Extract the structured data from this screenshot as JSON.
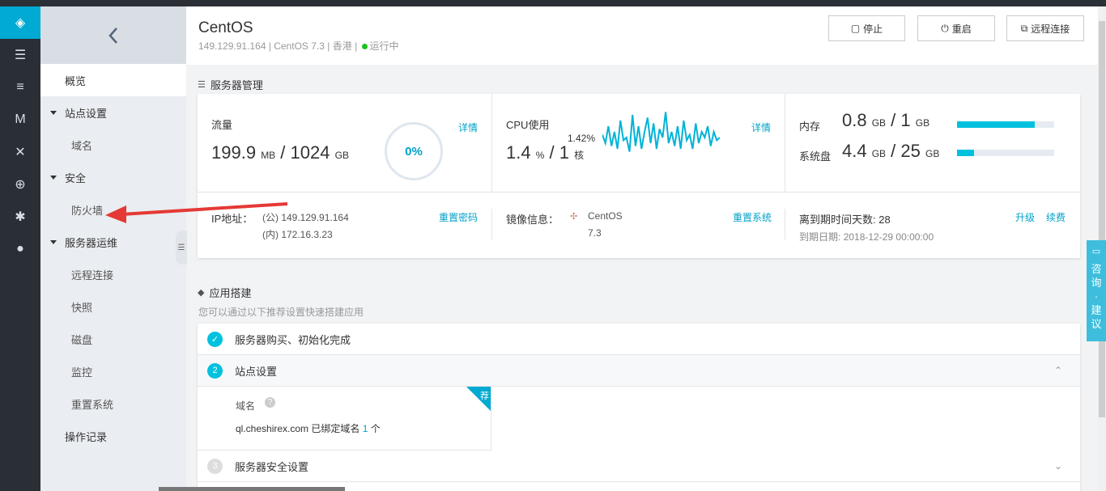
{
  "nav": {
    "back_icon": "chevron-left-icon",
    "items": [
      {
        "label": "概览"
      },
      {
        "label": "站点设置"
      },
      {
        "label": "域名"
      },
      {
        "label": "安全"
      },
      {
        "label": "防火墙"
      },
      {
        "label": "服务器运维"
      },
      {
        "label": "远程连接"
      },
      {
        "label": "快照"
      },
      {
        "label": "磁盘"
      },
      {
        "label": "监控"
      },
      {
        "label": "重置系统"
      },
      {
        "label": "操作记录"
      }
    ]
  },
  "header": {
    "title": "CentOS",
    "ip": "149.129.91.164",
    "os": "CentOS 7.3",
    "region": "香港",
    "status": "运行中",
    "status_color": "#1dc11d",
    "stop_label": "停止",
    "restart_label": "重启",
    "remote_label": "远程连接"
  },
  "server": {
    "section_title": "服务器管理",
    "traffic_label": "流量",
    "traffic_used": "199.9",
    "traffic_used_unit": "MB",
    "traffic_total": "1024",
    "traffic_total_unit": "GB",
    "traffic_percent": "0%",
    "detail_label": "详情",
    "cpu_label": "CPU使用",
    "cpu_used": "1.4",
    "cpu_unit": "%",
    "cpu_cores": "1",
    "cpu_core_unit": "核",
    "cpu_peak": "1.42%",
    "memory_label": "内存",
    "memory_used": "0.8",
    "memory_unit": "GB",
    "memory_total": "1",
    "memory_total_unit": "GB",
    "memory_fraction": 0.8,
    "disk_label": "系统盘",
    "disk_used": "4.4",
    "disk_unit": "GB",
    "disk_total": "25",
    "disk_total_unit": "GB",
    "disk_fraction": 0.176,
    "ip_label": "IP地址：",
    "ip_public": "(公) 149.129.91.164",
    "ip_private": "(内) 172.16.3.23",
    "reset_password": "重置密码",
    "image_label": "镜像信息：",
    "image_name": "CentOS",
    "image_version": "7.3",
    "reset_system": "重置系统",
    "expire_days_label": "离到期时间天数:",
    "expire_days": "28",
    "expire_date_label": "到期日期:",
    "expire_date": "2018-12-29 00:00:00",
    "upgrade": "升级",
    "renew": "续费"
  },
  "apps": {
    "section_title": "应用搭建",
    "subtitle": "您可以通过以下推荐设置快速搭建应用",
    "step1": "服务器购买、初始化完成",
    "step2_num": "2",
    "step2": "站点设置",
    "step3_num": "3",
    "step3": "服务器安全设置",
    "domain_label": "域名",
    "domain_text": "ql.cheshirex.com 已绑定域名",
    "domain_count": "1",
    "domain_unit": "个",
    "recommend_badge": "荐"
  },
  "consult": {
    "chars": [
      "咨",
      "询",
      "·",
      "建",
      "议"
    ]
  },
  "colors": {
    "accent": "#00a2ca",
    "sidebar_dark": "#2a2f36",
    "active_icon": "#00aad2",
    "arrow": "#e53935"
  },
  "cpu_series": [
    0.55,
    0.4,
    0.7,
    0.35,
    0.6,
    0.3,
    0.8,
    0.45,
    0.5,
    0.25,
    0.9,
    0.35,
    0.7,
    0.3,
    0.6,
    0.85,
    0.4,
    0.75,
    0.3,
    0.65,
    0.5,
    0.95,
    0.4,
    0.6,
    0.35,
    0.7,
    0.3,
    0.8,
    0.45,
    0.55,
    0.3,
    0.75,
    0.4,
    0.6,
    0.5,
    0.7,
    0.35,
    0.6,
    0.45,
    0.5
  ]
}
